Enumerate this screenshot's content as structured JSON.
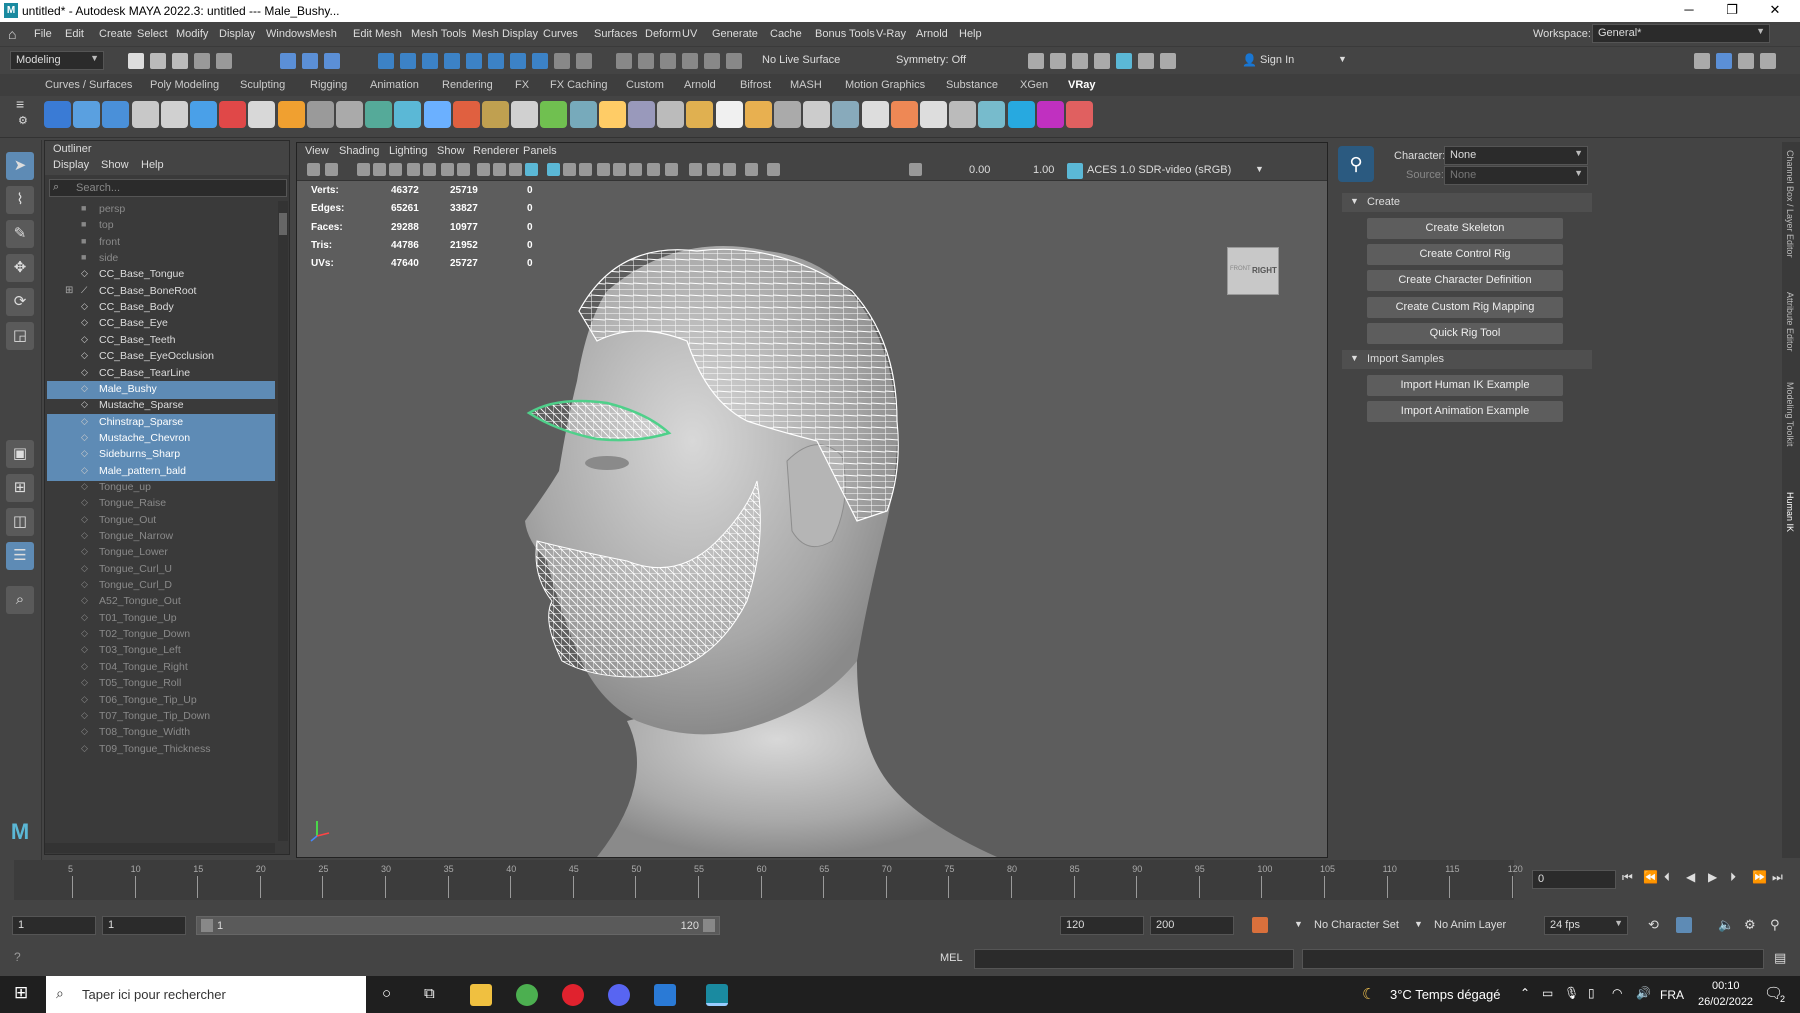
{
  "window": {
    "title": "untitled* - Autodesk MAYA 2022.3: untitled  ---  Male_Bushy...",
    "minimize": "─",
    "restore": "❐",
    "close": "✕"
  },
  "menu": [
    "File",
    "Edit",
    "Create",
    "Select",
    "Modify",
    "Display",
    "Windows",
    "Mesh",
    "Edit Mesh",
    "Mesh Tools",
    "Mesh Display",
    "Curves",
    "Surfaces",
    "Deform",
    "UV",
    "Generate",
    "Cache",
    "Bonus Tools",
    "V-Ray",
    "Arnold",
    "Help"
  ],
  "workspace": {
    "label": "Workspace:",
    "value": "General*"
  },
  "statusline": {
    "mode": "Modeling",
    "live_surface": "No Live Surface",
    "symmetry": "Symmetry: Off",
    "sign_in": "Sign In"
  },
  "shelf_tabs": [
    "Curves / Surfaces",
    "Poly Modeling",
    "Sculpting",
    "Rigging",
    "Animation",
    "Rendering",
    "FX",
    "FX Caching",
    "Custom",
    "Arnold",
    "Bifrost",
    "MASH",
    "Motion Graphics",
    "Substance",
    "XGen",
    "VRay"
  ],
  "shelf_active": "VRay",
  "outliner": {
    "title": "Outliner",
    "menu": [
      "Display",
      "Show",
      "Help"
    ],
    "search_placeholder": "Search...",
    "items": [
      {
        "name": "persp",
        "kind": "camera",
        "state": "dim"
      },
      {
        "name": "top",
        "kind": "camera",
        "state": "dim"
      },
      {
        "name": "front",
        "kind": "camera",
        "state": "dim"
      },
      {
        "name": "side",
        "kind": "camera",
        "state": "dim"
      },
      {
        "name": "CC_Base_Tongue",
        "kind": "mesh",
        "state": "normal"
      },
      {
        "name": "CC_Base_BoneRoot",
        "kind": "joint",
        "state": "normal"
      },
      {
        "name": "CC_Base_Body",
        "kind": "mesh",
        "state": "normal"
      },
      {
        "name": "CC_Base_Eye",
        "kind": "mesh",
        "state": "normal"
      },
      {
        "name": "CC_Base_Teeth",
        "kind": "mesh",
        "state": "normal"
      },
      {
        "name": "CC_Base_EyeOcclusion",
        "kind": "mesh",
        "state": "normal"
      },
      {
        "name": "CC_Base_TearLine",
        "kind": "mesh",
        "state": "normal"
      },
      {
        "name": "Male_Bushy",
        "kind": "mesh",
        "state": "selected"
      },
      {
        "name": "Mustache_Sparse",
        "kind": "mesh",
        "state": "normal"
      },
      {
        "name": "Chinstrap_Sparse",
        "kind": "mesh",
        "state": "selected"
      },
      {
        "name": "Mustache_Chevron",
        "kind": "mesh",
        "state": "selected"
      },
      {
        "name": "Sideburns_Sharp",
        "kind": "mesh",
        "state": "selected"
      },
      {
        "name": "Male_pattern_bald",
        "kind": "mesh",
        "state": "selected"
      },
      {
        "name": "Tongue_up",
        "kind": "mesh",
        "state": "dim"
      },
      {
        "name": "Tongue_Raise",
        "kind": "mesh",
        "state": "dim"
      },
      {
        "name": "Tongue_Out",
        "kind": "mesh",
        "state": "dim"
      },
      {
        "name": "Tongue_Narrow",
        "kind": "mesh",
        "state": "dim"
      },
      {
        "name": "Tongue_Lower",
        "kind": "mesh",
        "state": "dim"
      },
      {
        "name": "Tongue_Curl_U",
        "kind": "mesh",
        "state": "dim"
      },
      {
        "name": "Tongue_Curl_D",
        "kind": "mesh",
        "state": "dim"
      },
      {
        "name": "A52_Tongue_Out",
        "kind": "mesh",
        "state": "dim"
      },
      {
        "name": "T01_Tongue_Up",
        "kind": "mesh",
        "state": "dim"
      },
      {
        "name": "T02_Tongue_Down",
        "kind": "mesh",
        "state": "dim"
      },
      {
        "name": "T03_Tongue_Left",
        "kind": "mesh",
        "state": "dim"
      },
      {
        "name": "T04_Tongue_Right",
        "kind": "mesh",
        "state": "dim"
      },
      {
        "name": "T05_Tongue_Roll",
        "kind": "mesh",
        "state": "dim"
      },
      {
        "name": "T06_Tongue_Tip_Up",
        "kind": "mesh",
        "state": "dim"
      },
      {
        "name": "T07_Tongue_Tip_Down",
        "kind": "mesh",
        "state": "dim"
      },
      {
        "name": "T08_Tongue_Width",
        "kind": "mesh",
        "state": "dim"
      },
      {
        "name": "T09_Tongue_Thickness",
        "kind": "mesh",
        "state": "dim"
      }
    ]
  },
  "viewport": {
    "menu": [
      "View",
      "Shading",
      "Lighting",
      "Show",
      "Renderer",
      "Panels"
    ],
    "exposure": "0.00",
    "gamma": "1.00",
    "color_space": "ACES 1.0 SDR-video (sRGB)",
    "viewcube_label": "RIGHT",
    "viewcube_side": "FRONT",
    "hud": [
      {
        "label": "Verts:",
        "a": "46372",
        "b": "25719",
        "c": "0"
      },
      {
        "label": "Edges:",
        "a": "65261",
        "b": "33827",
        "c": "0"
      },
      {
        "label": "Faces:",
        "a": "29288",
        "b": "10977",
        "c": "0"
      },
      {
        "label": "Tris:",
        "a": "44786",
        "b": "21952",
        "c": "0"
      },
      {
        "label": "UVs:",
        "a": "47640",
        "b": "25727",
        "c": "0"
      }
    ]
  },
  "hik": {
    "character_label": "Character:",
    "character_value": "None",
    "source_label": "Source:",
    "source_value": "None",
    "create_section": "Create",
    "create_buttons": [
      "Create Skeleton",
      "Create Control Rig",
      "Create Character Definition",
      "Create Custom Rig Mapping",
      "Quick Rig Tool"
    ],
    "import_section": "Import Samples",
    "import_buttons": [
      "Import Human IK Example",
      "Import Animation Example"
    ]
  },
  "side_tabs": [
    "Channel Box / Layer Editor",
    "Attribute Editor",
    "Modeling Toolkit",
    "Human IK"
  ],
  "timeline": {
    "ticks": [
      "5",
      "10",
      "15",
      "20",
      "25",
      "30",
      "35",
      "40",
      "45",
      "50",
      "55",
      "60",
      "65",
      "70",
      "75",
      "80",
      "85",
      "90",
      "95",
      "100",
      "105",
      "110",
      "115",
      "120"
    ],
    "current_frame": "0"
  },
  "range": {
    "start": "1",
    "playback_start": "1",
    "slider_start": "1",
    "slider_end": "120",
    "playback_end": "120",
    "end": "200",
    "character_set": "No Character Set",
    "anim_layer": "No Anim Layer",
    "fps": "24 fps"
  },
  "cmdline": {
    "lang": "MEL"
  },
  "taskbar": {
    "search_placeholder": "Taper ici pour rechercher",
    "weather": "3°C  Temps dégagé",
    "lang": "FRA",
    "time": "00:10",
    "date": "26/02/2022",
    "notifications": "2"
  },
  "colors": {
    "selection": "#5e8bb5",
    "accent": "#5bb8d6",
    "brow_wire": "#4fd08a"
  }
}
